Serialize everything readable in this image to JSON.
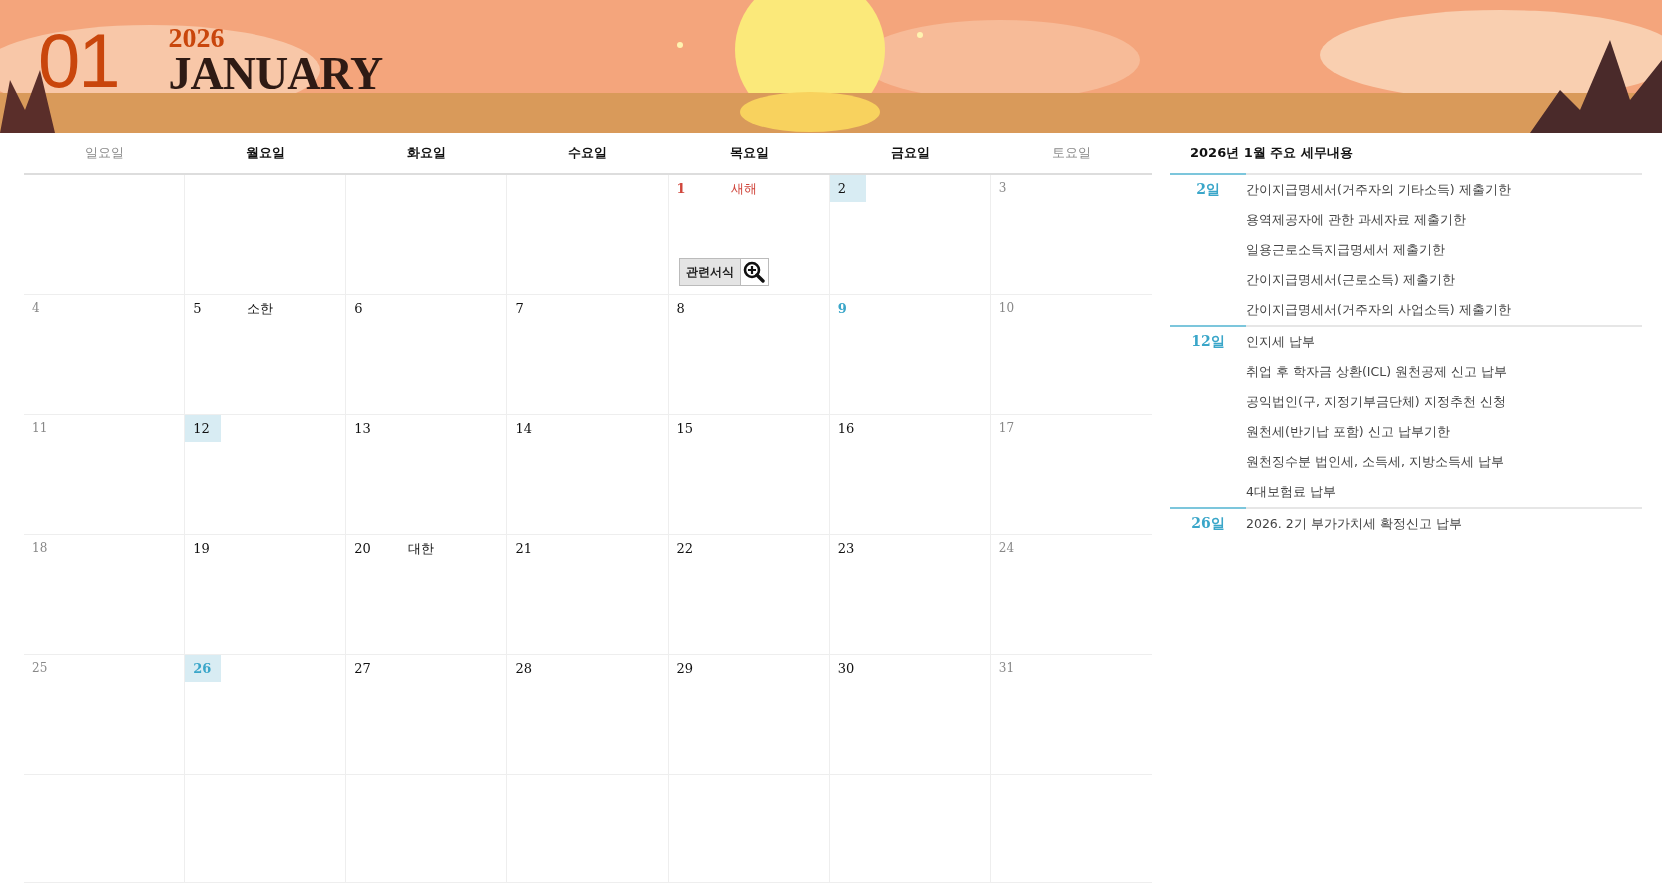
{
  "banner": {
    "month_number": "01",
    "year": "2026",
    "month_name": "JANUARY"
  },
  "calendar": {
    "weekdays": [
      {
        "label": "일요일",
        "kind": "weekend"
      },
      {
        "label": "월요일",
        "kind": "weekday"
      },
      {
        "label": "화요일",
        "kind": "weekday"
      },
      {
        "label": "수요일",
        "kind": "weekday"
      },
      {
        "label": "목요일",
        "kind": "weekday"
      },
      {
        "label": "금요일",
        "kind": "weekday"
      },
      {
        "label": "토요일",
        "kind": "weekend"
      }
    ],
    "weeks": [
      [
        {
          "kind": "empty"
        },
        {
          "kind": "empty"
        },
        {
          "kind": "empty"
        },
        {
          "kind": "empty"
        },
        {
          "kind": "holiday",
          "day": "1",
          "note": "새해",
          "highlighted": false,
          "button": "관련서식"
        },
        {
          "kind": "weekday",
          "day": "2",
          "highlighted": true
        },
        {
          "kind": "weekend",
          "day": "3",
          "highlighted": false
        }
      ],
      [
        {
          "kind": "weekend",
          "day": "4",
          "highlighted": false
        },
        {
          "kind": "weekday",
          "day": "5",
          "note": "소한",
          "highlighted": false
        },
        {
          "kind": "weekday",
          "day": "6",
          "highlighted": false
        },
        {
          "kind": "weekday",
          "day": "7",
          "highlighted": false
        },
        {
          "kind": "weekday",
          "day": "8",
          "highlighted": false
        },
        {
          "kind": "accent",
          "day": "9",
          "highlighted": false
        },
        {
          "kind": "weekend",
          "day": "10",
          "highlighted": false
        }
      ],
      [
        {
          "kind": "weekend",
          "day": "11",
          "highlighted": false
        },
        {
          "kind": "weekday",
          "day": "12",
          "highlighted": true
        },
        {
          "kind": "weekday",
          "day": "13",
          "highlighted": false
        },
        {
          "kind": "weekday",
          "day": "14",
          "highlighted": false
        },
        {
          "kind": "weekday",
          "day": "15",
          "highlighted": false
        },
        {
          "kind": "weekday",
          "day": "16",
          "highlighted": false
        },
        {
          "kind": "weekend",
          "day": "17",
          "highlighted": false
        }
      ],
      [
        {
          "kind": "weekend",
          "day": "18",
          "highlighted": false
        },
        {
          "kind": "weekday",
          "day": "19",
          "highlighted": false
        },
        {
          "kind": "weekday",
          "day": "20",
          "note": "대한",
          "highlighted": false
        },
        {
          "kind": "weekday",
          "day": "21",
          "highlighted": false
        },
        {
          "kind": "weekday",
          "day": "22",
          "highlighted": false
        },
        {
          "kind": "weekday",
          "day": "23",
          "highlighted": false
        },
        {
          "kind": "weekend",
          "day": "24",
          "highlighted": false
        }
      ],
      [
        {
          "kind": "weekend",
          "day": "25",
          "highlighted": false
        },
        {
          "kind": "accent",
          "day": "26",
          "highlighted": true
        },
        {
          "kind": "weekday",
          "day": "27",
          "highlighted": false
        },
        {
          "kind": "weekday",
          "day": "28",
          "highlighted": false
        },
        {
          "kind": "weekday",
          "day": "29",
          "highlighted": false
        },
        {
          "kind": "weekday",
          "day": "30",
          "highlighted": false
        },
        {
          "kind": "weekend",
          "day": "31",
          "highlighted": false
        }
      ],
      [
        {
          "kind": "empty"
        },
        {
          "kind": "empty"
        },
        {
          "kind": "empty"
        },
        {
          "kind": "empty"
        },
        {
          "kind": "empty"
        },
        {
          "kind": "empty"
        },
        {
          "kind": "empty"
        }
      ]
    ]
  },
  "tax_panel": {
    "title": "2026년 1월 주요 세무내용",
    "groups": [
      {
        "date": "2일",
        "items": [
          "간이지급명세서(거주자의 기타소득) 제출기한",
          "용역제공자에 관한 과세자료 제출기한",
          "일용근로소득지급명세서 제출기한",
          "간이지급명세서(근로소득) 제출기한",
          "간이지급명세서(거주자의 사업소득) 제출기한"
        ]
      },
      {
        "date": "12일",
        "items": [
          "인지세 납부",
          "취업 후 학자금 상환(ICL) 원천공제 신고 납부",
          "공익법인(구, 지정기부금단체) 지정추천 신청",
          "원천세(반기납 포함) 신고 납부기한",
          "원천징수분 법인세, 소득세, 지방소득세 납부",
          "4대보험료 납부"
        ]
      },
      {
        "date": "26일",
        "items": [
          "2026. 2기 부가가치세 확정신고 납부"
        ]
      }
    ]
  }
}
